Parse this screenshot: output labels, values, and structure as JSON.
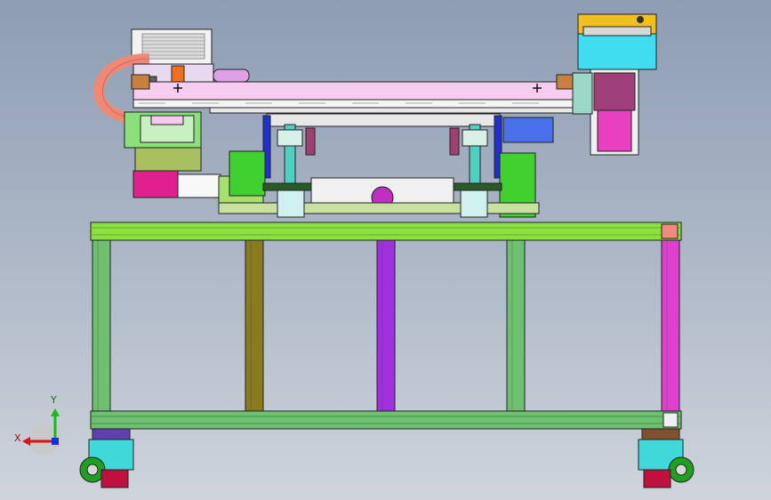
{
  "viewport": {
    "background_top": "#8e9db4",
    "background_bottom": "#cfd4dc"
  },
  "triad": {
    "x_label": "X",
    "y_label": "Y",
    "x_color": "#e01010",
    "y_color": "#18b818",
    "z_color": "#1030e0",
    "icon": "coordinate-triad-icon"
  },
  "colors": {
    "frame_green": "#8ce040",
    "frame_leg_green": "#6ec070",
    "post_olive": "#8a7a20",
    "post_purple": "#a030e0",
    "post_magenta": "#e040d0",
    "rail_pink": "#f6ccf0",
    "cylinder_cyan": "#4cc8e8",
    "orange_block": "#f0a020",
    "caster_cyan": "#40d8d8",
    "caster_wheel": "#c01040"
  }
}
